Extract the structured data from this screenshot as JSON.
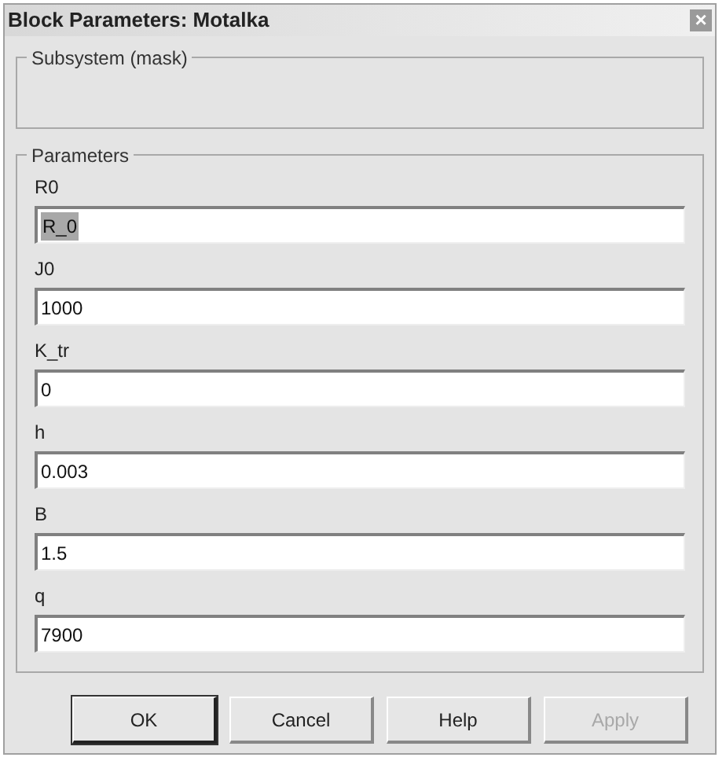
{
  "window": {
    "title": "Block Parameters: Motalka",
    "close": "×"
  },
  "description_group": {
    "title": "Subsystem (mask)"
  },
  "parameters_group": {
    "title": "Parameters"
  },
  "parameters": [
    {
      "label": "R0",
      "value": "R_0",
      "text_selected": true
    },
    {
      "label": "J0",
      "value": "1000",
      "text_selected": false
    },
    {
      "label": "K_tr",
      "value": "0",
      "text_selected": false
    },
    {
      "label": "h",
      "value": "0.003",
      "text_selected": false
    },
    {
      "label": "B",
      "value": "1.5",
      "text_selected": false
    },
    {
      "label": "q",
      "value": "7900",
      "text_selected": false
    }
  ],
  "buttons": [
    {
      "label": "OK",
      "default": true,
      "disabled": false
    },
    {
      "label": "Cancel",
      "default": false,
      "disabled": false
    },
    {
      "label": "Help",
      "default": false,
      "disabled": false
    },
    {
      "label": "Apply",
      "default": false,
      "disabled": true
    }
  ]
}
